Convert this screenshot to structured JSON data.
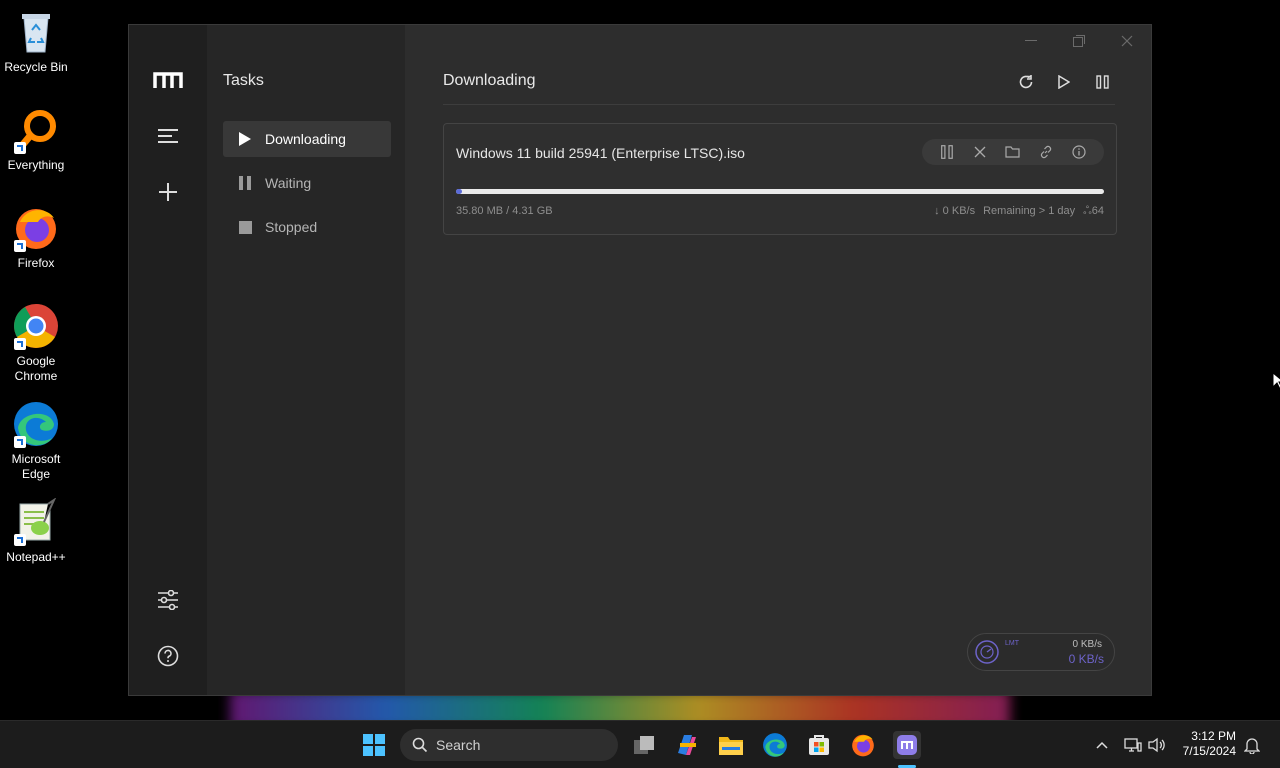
{
  "desktop": {
    "icons": [
      {
        "label": "Recycle Bin",
        "icon": "recycle-bin-icon"
      },
      {
        "label": "Everything",
        "icon": "everything-search-icon"
      },
      {
        "label": "Firefox",
        "icon": "firefox-icon"
      },
      {
        "label": "Google Chrome",
        "icon": "chrome-icon"
      },
      {
        "label": "Microsoft Edge",
        "icon": "edge-icon"
      },
      {
        "label": "Notepad++",
        "icon": "notepadpp-icon"
      }
    ]
  },
  "app": {
    "window_controls": [
      "minimize",
      "maximize",
      "close"
    ],
    "rail": {
      "logo": "motrix-logo-icon",
      "items": [
        "menu-icon",
        "add-icon",
        "preferences-icon",
        "help-icon"
      ]
    },
    "sidebar": {
      "title": "Tasks",
      "items": [
        {
          "label": "Downloading",
          "icon": "play-icon",
          "active": true
        },
        {
          "label": "Waiting",
          "icon": "pause-icon",
          "active": false
        },
        {
          "label": "Stopped",
          "icon": "stop-icon",
          "active": false
        }
      ]
    },
    "main": {
      "title": "Downloading",
      "toolbar": [
        "refresh-icon",
        "resume-all-icon",
        "pause-all-icon"
      ]
    },
    "task": {
      "name": "Windows 11 build 25941 (Enterprise LTSC).iso",
      "progress": 0.008,
      "size_text": "35.80 MB / 4.31 GB",
      "speed_text": "↓ 0 KB/s",
      "remaining_text": "Remaining > 1 day",
      "connections_text": "ஃ64",
      "actions": [
        "pause-icon",
        "delete-icon",
        "folder-icon",
        "link-icon",
        "info-icon"
      ]
    },
    "speed": {
      "upload": "0 KB/s",
      "download": "0 KB/s",
      "mode_badge": "LMT"
    }
  },
  "taskbar": {
    "search_placeholder": "Search",
    "time": "3:12 PM",
    "date": "7/15/2024",
    "colors": {
      "accent": "#5b6bd8",
      "speed": "#6d63c9"
    }
  }
}
